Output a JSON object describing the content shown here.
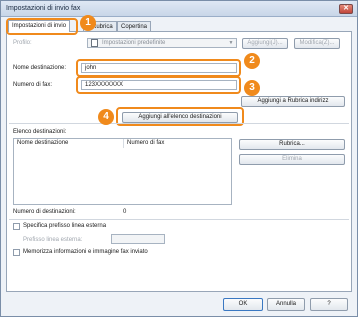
{
  "window": {
    "title": "Impostazioni di invio fax",
    "close_glyph": "✕"
  },
  "tabs": [
    {
      "label": "Impostazioni di invio"
    },
    {
      "label": "Rubrica"
    },
    {
      "label": "Copertina"
    }
  ],
  "profile": {
    "label": "Profilo:",
    "value": "Impostazioni predefinite",
    "add_label": "Aggiungi(J)...",
    "modify_label": "Modifica(Z)..."
  },
  "destination": {
    "name_label": "Nome destinazione:",
    "name_value": "john",
    "fax_label": "Numero di fax:",
    "fax_value": "123XXXXXXX"
  },
  "buttons": {
    "add_to_addressbook": "Aggiungi a Rubrica indirizz",
    "add_to_list": "Aggiungi all'elenco destinazioni",
    "addressbook": "Rubrica...",
    "remove": "Elimina",
    "ok": "OK",
    "cancel": "Annulla",
    "help": "?"
  },
  "destination_list": {
    "label": "Elenco destinazioni:",
    "columns": [
      "Nome destinazione",
      "Numero di fax"
    ],
    "rows": []
  },
  "count": {
    "label": "Numero di destinazioni:",
    "value": "0"
  },
  "outside_line": {
    "checkbox_label": "Specifica prefisso linea esterna",
    "prefix_label": "Prefisso linea esterna:",
    "prefix_value": ""
  },
  "store": {
    "checkbox_label": "Memorizza informazioni e immagine fax inviato"
  },
  "callouts": [
    "1",
    "2",
    "3",
    "4"
  ],
  "colors": {
    "callout": "#f08a1c",
    "frame": "#7a8ea8"
  }
}
